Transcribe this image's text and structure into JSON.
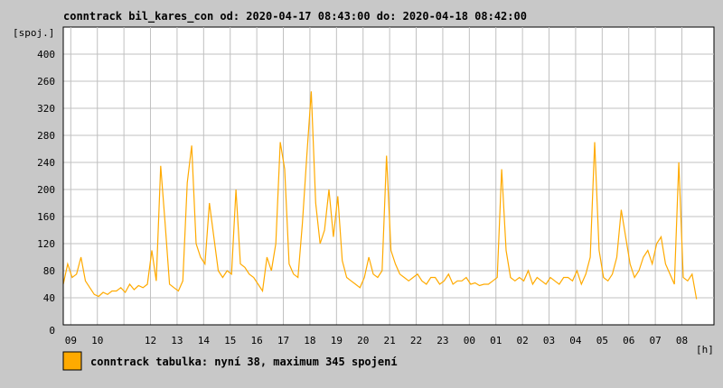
{
  "chart_data": {
    "type": "line",
    "title": "conntrack bil_kares_con od: 2020-04-17 08:43:00 do: 2020-04-18 08:42:00",
    "ylabel": "[spoj.]",
    "xlabel": "[h]",
    "ylim": [
      0,
      440
    ],
    "y_ticks": [
      0,
      40,
      80,
      120,
      160,
      200,
      240,
      280,
      320,
      360,
      400
    ],
    "y_tick_labels": [
      "0",
      "40",
      "80",
      "120",
      "160",
      "200",
      "240",
      "280",
      "320",
      "260",
      "400"
    ],
    "x_start_hour": 8.7167,
    "x_step_minutes": 10,
    "x_tick_hours": [
      9,
      10,
      11,
      12,
      13,
      14,
      15,
      16,
      17,
      18,
      19,
      20,
      21,
      22,
      23,
      24,
      25,
      26,
      27,
      28,
      29,
      30,
      31,
      32
    ],
    "x_tick_labels": [
      "09",
      "10",
      "",
      "12",
      "13",
      "14",
      "15",
      "16",
      "17",
      "18",
      "19",
      "20",
      "21",
      "22",
      "23",
      "00",
      "01",
      "02",
      "03",
      "04",
      "05",
      "06",
      "07",
      "08"
    ],
    "grid": true,
    "color": "#ffaa00",
    "series": [
      {
        "name": "conntrack tabulka",
        "values": [
          60,
          90,
          70,
          75,
          100,
          65,
          55,
          45,
          42,
          48,
          45,
          50,
          50,
          55,
          48,
          60,
          52,
          58,
          55,
          60,
          110,
          65,
          235,
          150,
          60,
          55,
          50,
          65,
          210,
          265,
          120,
          100,
          90,
          180,
          130,
          80,
          70,
          80,
          75,
          200,
          90,
          85,
          75,
          70,
          60,
          50,
          100,
          80,
          120,
          270,
          230,
          90,
          75,
          70,
          150,
          250,
          345,
          180,
          120,
          140,
          200,
          130,
          190,
          95,
          70,
          65,
          60,
          55,
          70,
          100,
          75,
          70,
          80,
          250,
          110,
          90,
          75,
          70,
          65,
          70,
          75,
          65,
          60,
          70,
          70,
          60,
          65,
          75,
          60,
          65,
          65,
          70,
          60,
          62,
          58,
          60,
          60,
          65,
          70,
          230,
          110,
          70,
          65,
          70,
          65,
          80,
          60,
          70,
          65,
          60,
          70,
          65,
          60,
          70,
          70,
          65,
          80,
          60,
          75,
          100,
          270,
          110,
          70,
          65,
          75,
          100,
          170,
          130,
          90,
          70,
          80,
          100,
          110,
          90,
          120,
          130,
          90,
          75,
          60,
          240,
          70,
          65,
          75,
          38
        ]
      }
    ],
    "legend": {
      "label": "conntrack tabulka: nyní 38, maximum 345 spojení",
      "placement": "bottom-left"
    }
  }
}
